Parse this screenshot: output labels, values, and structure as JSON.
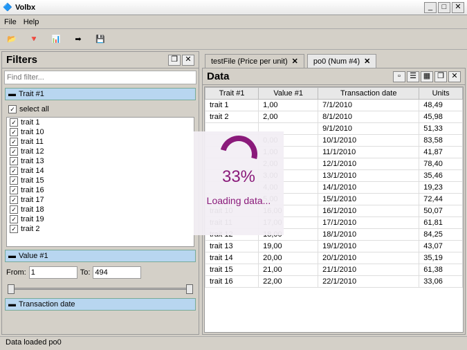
{
  "window": {
    "title": "Volbx"
  },
  "menu": {
    "file": "File",
    "help": "Help"
  },
  "filters": {
    "title": "Filters",
    "find_placeholder": "Find filter...",
    "trait_header": "Trait #1",
    "select_all": "select all",
    "traits": [
      "trait 1",
      "trait 10",
      "trait 11",
      "trait 12",
      "trait 13",
      "trait 14",
      "trait 15",
      "trait 16",
      "trait 17",
      "trait 18",
      "trait 19",
      "trait 2"
    ],
    "value_header": "Value #1",
    "from_label": "From:",
    "from_value": "1",
    "to_label": "To:",
    "to_value": "494",
    "transaction_header": "Transaction date"
  },
  "tabs": [
    {
      "label": "testFile (Price per unit)"
    },
    {
      "label": "po0 (Num #4)"
    }
  ],
  "data": {
    "title": "Data",
    "columns": [
      "Trait #1",
      "Value #1",
      "Transaction date",
      "Units"
    ],
    "rows": [
      [
        "trait 1",
        "1,00",
        "7/1/2010",
        "48,49"
      ],
      [
        "trait 2",
        "2,00",
        "8/1/2010",
        "45,98"
      ],
      [
        "",
        "",
        "9/1/2010",
        "51,33"
      ],
      [
        "",
        "0,00",
        "10/1/2010",
        "83,58"
      ],
      [
        "",
        "1,00",
        "11/1/2010",
        "41,87"
      ],
      [
        "",
        "2,00",
        "12/1/2010",
        "78,40"
      ],
      [
        "",
        "3,00",
        "13/1/2010",
        "35,46"
      ],
      [
        "",
        "4,00",
        "14/1/2010",
        "19,23"
      ],
      [
        "",
        "5,00",
        "15/1/2010",
        "72,44"
      ],
      [
        "trait 10",
        "16,00",
        "16/1/2010",
        "50,07"
      ],
      [
        "trait 11",
        "17,00",
        "17/1/2010",
        "61,81"
      ],
      [
        "trait 12",
        "18,00",
        "18/1/2010",
        "84,25"
      ],
      [
        "trait 13",
        "19,00",
        "19/1/2010",
        "43,07"
      ],
      [
        "trait 14",
        "20,00",
        "20/1/2010",
        "35,19"
      ],
      [
        "trait 15",
        "21,00",
        "21/1/2010",
        "61,38"
      ],
      [
        "trait 16",
        "22,00",
        "22/1/2010",
        "33,06"
      ]
    ]
  },
  "loading": {
    "percent": "33%",
    "text": "Loading data..."
  },
  "status": "Data loaded po0"
}
